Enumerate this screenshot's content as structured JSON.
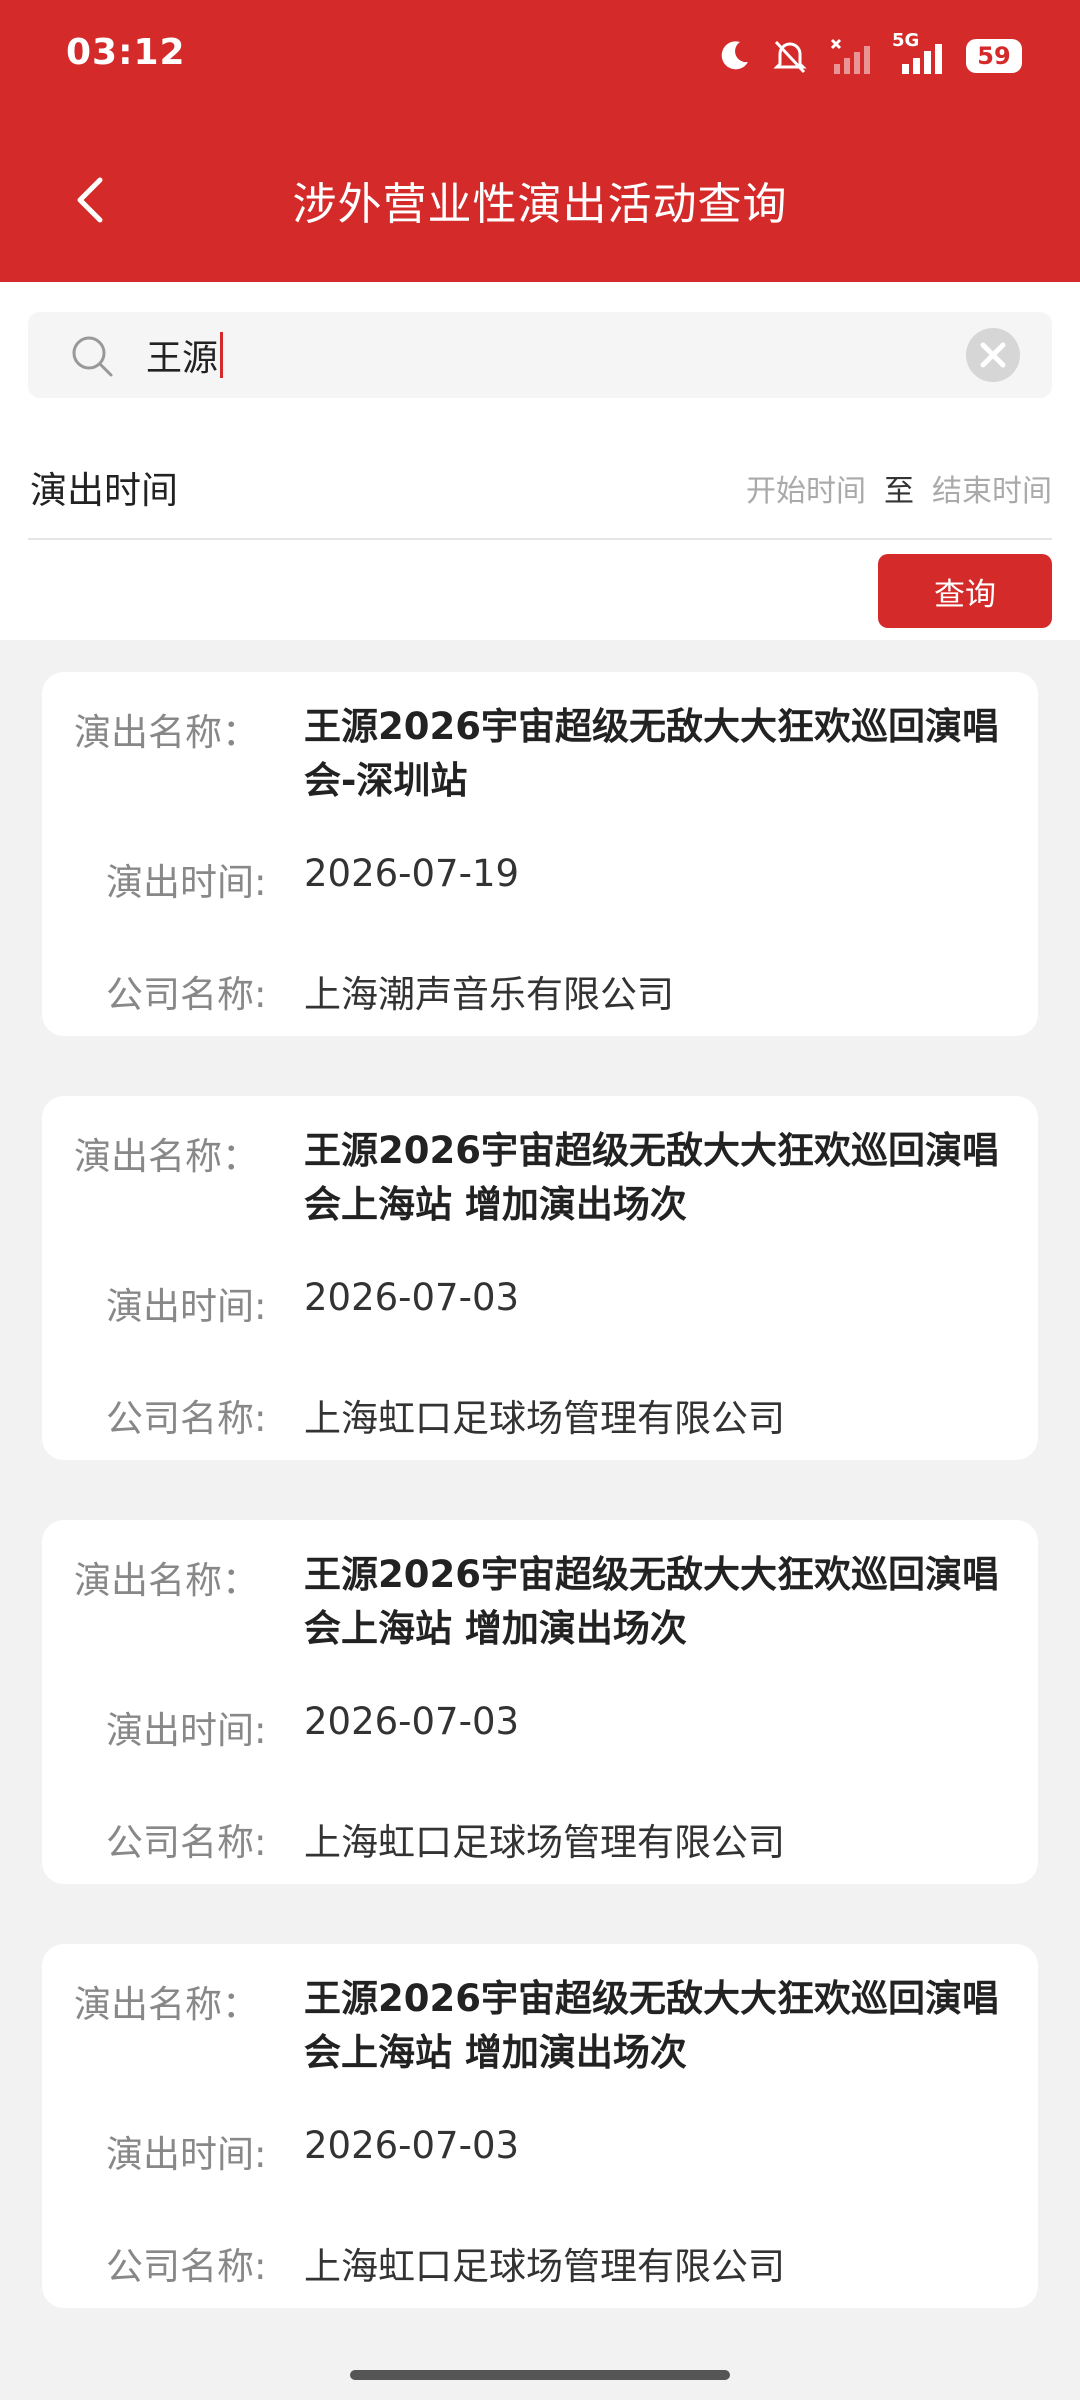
{
  "status_bar": {
    "time": "03:12",
    "network": "5G",
    "battery": "59",
    "icons": [
      "moon-icon",
      "mute-icon",
      "signal-icon",
      "battery-icon"
    ]
  },
  "header": {
    "title": "涉外营业性演出活动查询",
    "back_icon": "chevron-left-icon",
    "color": "#d42a2a"
  },
  "search": {
    "value": "王源",
    "icon": "search-icon",
    "clear_icon": "clear-icon"
  },
  "filter": {
    "time_label": "演出时间",
    "start_placeholder": "开始时间",
    "separator": "至",
    "end_placeholder": "结束时间",
    "query_label": "查询"
  },
  "labels": {
    "name": "演出名称：",
    "date": "演出时间:",
    "company": "公司名称:"
  },
  "results": [
    {
      "name": "王源2026宇宙超级无敌大大狂欢巡回演唱会-深圳站",
      "date": "2026-07-19",
      "company": "上海潮声音乐有限公司"
    },
    {
      "name": "王源2026宇宙超级无敌大大狂欢巡回演唱会上海站 增加演出场次",
      "date": "2026-07-03",
      "company": "上海虹口足球场管理有限公司"
    },
    {
      "name": "王源2026宇宙超级无敌大大狂欢巡回演唱会上海站 增加演出场次",
      "date": "2026-07-03",
      "company": "上海虹口足球场管理有限公司"
    },
    {
      "name": "王源2026宇宙超级无敌大大狂欢巡回演唱会上海站 增加演出场次",
      "date": "2026-07-03",
      "company": "上海虹口足球场管理有限公司"
    }
  ]
}
